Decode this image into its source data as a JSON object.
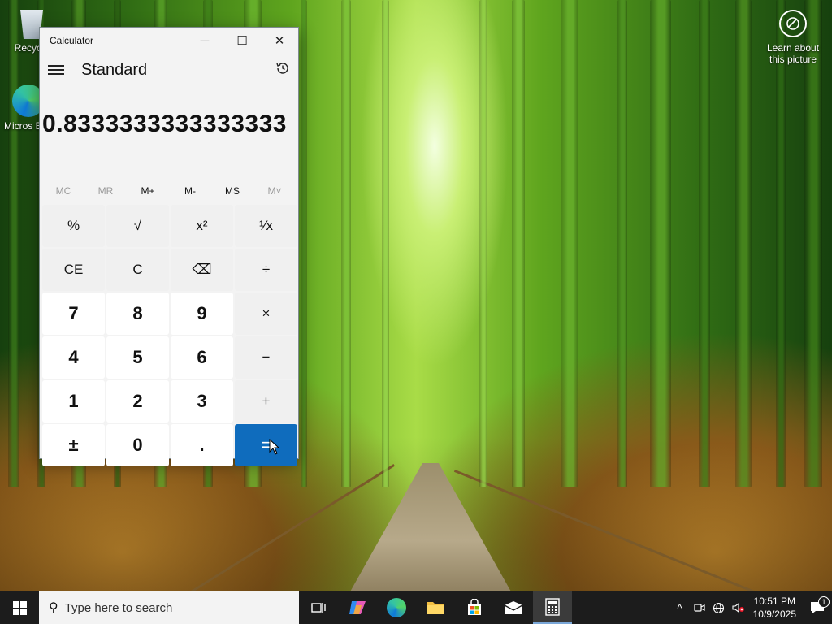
{
  "desktop": {
    "icons": [
      {
        "label": "Recycle",
        "icon": "recycle-bin-icon"
      },
      {
        "label": "Micros Edg",
        "icon": "edge-icon"
      }
    ],
    "learn_about": {
      "line1": "Learn about",
      "line2": "this picture",
      "icon": "camera-lens-icon"
    }
  },
  "calculator": {
    "window_title": "Calculator",
    "window_controls": {
      "minimize": "─",
      "maximize": "☐",
      "close": "✕"
    },
    "mode": "Standard",
    "display_value": "0.8333333333333333",
    "memory": [
      {
        "label": "MC",
        "enabled": false
      },
      {
        "label": "MR",
        "enabled": false
      },
      {
        "label": "M+",
        "enabled": true
      },
      {
        "label": "M-",
        "enabled": true
      },
      {
        "label": "MS",
        "enabled": true
      },
      {
        "label": "M˅",
        "enabled": false
      }
    ],
    "keys": [
      {
        "label": "%",
        "name": "percent-button",
        "kind": "fn"
      },
      {
        "label": "√",
        "name": "sqrt-button",
        "kind": "fn"
      },
      {
        "label": "x²",
        "name": "square-button",
        "kind": "fn"
      },
      {
        "label": "¹⁄x",
        "name": "reciprocal-button",
        "kind": "fn"
      },
      {
        "label": "CE",
        "name": "clear-entry-button",
        "kind": "fn"
      },
      {
        "label": "C",
        "name": "clear-button",
        "kind": "fn"
      },
      {
        "label": "⌫",
        "name": "backspace-button",
        "kind": "fn"
      },
      {
        "label": "÷",
        "name": "divide-button",
        "kind": "fn"
      },
      {
        "label": "7",
        "name": "digit-7-button",
        "kind": "num"
      },
      {
        "label": "8",
        "name": "digit-8-button",
        "kind": "num"
      },
      {
        "label": "9",
        "name": "digit-9-button",
        "kind": "num"
      },
      {
        "label": "×",
        "name": "multiply-button",
        "kind": "fn"
      },
      {
        "label": "4",
        "name": "digit-4-button",
        "kind": "num"
      },
      {
        "label": "5",
        "name": "digit-5-button",
        "kind": "num"
      },
      {
        "label": "6",
        "name": "digit-6-button",
        "kind": "num"
      },
      {
        "label": "−",
        "name": "subtract-button",
        "kind": "fn"
      },
      {
        "label": "1",
        "name": "digit-1-button",
        "kind": "num"
      },
      {
        "label": "2",
        "name": "digit-2-button",
        "kind": "num"
      },
      {
        "label": "3",
        "name": "digit-3-button",
        "kind": "num"
      },
      {
        "label": "+",
        "name": "add-button",
        "kind": "fn"
      },
      {
        "label": "±",
        "name": "negate-button",
        "kind": "num"
      },
      {
        "label": "0",
        "name": "digit-0-button",
        "kind": "num"
      },
      {
        "label": ".",
        "name": "decimal-button",
        "kind": "num"
      },
      {
        "label": "=",
        "name": "equals-button",
        "kind": "eq"
      }
    ]
  },
  "taskbar": {
    "search_placeholder": "Type here to search",
    "pinned": [
      "task-view-icon",
      "copilot-icon",
      "edge-icon",
      "file-explorer-icon",
      "microsoft-store-icon",
      "mail-icon",
      "calculator-icon"
    ],
    "active": "calculator-icon",
    "time": "10:51 PM",
    "date": "10/9/2025",
    "notification_count": "1"
  },
  "colors": {
    "accent": "#0f6cbd",
    "taskbar": "#1c1c1c"
  }
}
